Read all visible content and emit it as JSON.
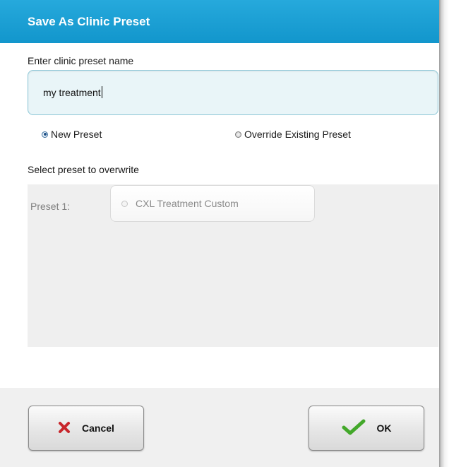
{
  "dialog": {
    "title": "Save As Clinic Preset"
  },
  "name_field": {
    "label": "Enter clinic preset name",
    "value": "my treatment"
  },
  "mode": {
    "options": [
      {
        "label": "New Preset",
        "checked": true
      },
      {
        "label": "Override Existing Preset",
        "checked": false
      }
    ]
  },
  "overwrite": {
    "label": "Select preset to overwrite",
    "presets": [
      {
        "slot_label": "Preset 1:",
        "name": "CXL Treatment Custom",
        "checked": false,
        "enabled": false
      }
    ]
  },
  "buttons": {
    "cancel_label": "Cancel",
    "ok_label": "OK"
  },
  "icons": {
    "cancel": "x-mark-icon",
    "ok": "checkmark-icon"
  },
  "colors": {
    "title_bar": "#1a9fd4",
    "input_bg": "#e9f5f8",
    "cancel_icon": "#c8262b",
    "ok_icon": "#43a82a"
  }
}
